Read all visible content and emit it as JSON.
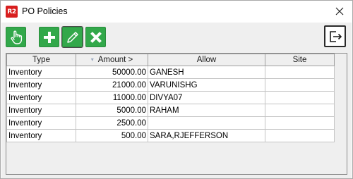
{
  "window": {
    "icon_text": "R2",
    "title": "PO Policies"
  },
  "toolbar": {
    "buttons": [
      {
        "icon": "hand-pointer-icon"
      },
      {
        "icon": "plus-icon"
      },
      {
        "icon": "pencil-icon"
      },
      {
        "icon": "close-x-icon"
      }
    ],
    "exit_icon": "exit-door-icon",
    "accent": "#32a84a"
  },
  "grid": {
    "columns": [
      "Type",
      "Amount >",
      "Allow",
      "Site"
    ],
    "sort_indicator": "▾",
    "rows": [
      {
        "type": "Inventory",
        "amount": "50000.00",
        "allow": "GANESH",
        "site": ""
      },
      {
        "type": "Inventory",
        "amount": "21000.00",
        "allow": "VARUNISHG",
        "site": ""
      },
      {
        "type": "Inventory",
        "amount": "11000.00",
        "allow": "DIVYA07",
        "site": ""
      },
      {
        "type": "Inventory",
        "amount": "5000.00",
        "allow": "RAHAM",
        "site": ""
      },
      {
        "type": "Inventory",
        "amount": "2500.00",
        "allow": "",
        "site": ""
      },
      {
        "type": "Inventory",
        "amount": "500.00",
        "allow": "SARA,RJEFFERSON",
        "site": ""
      }
    ]
  }
}
